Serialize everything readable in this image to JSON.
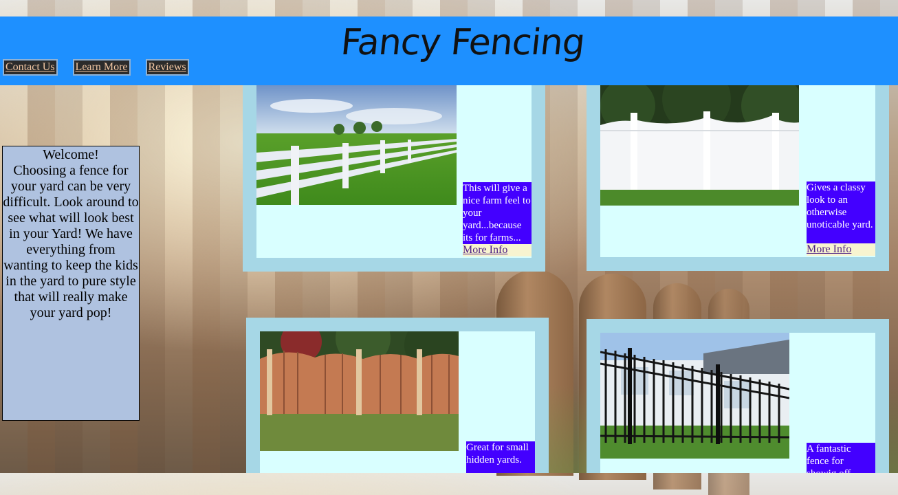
{
  "header": {
    "title": "Fancy Fencing",
    "nav": [
      "Contact Us",
      "Learn More",
      "Reviews"
    ]
  },
  "welcome": {
    "heading": "Welcome!",
    "text": "Choosing a fence for your yard can be very difficult. Look around to see what will look best in your Yard! We have everything from wanting to keep the kids in the yard to pure style that will really make your yard pop!"
  },
  "cards": [
    {
      "image": "white rail farm fence in grassy field",
      "description": "This will give a nice farm feel to your yard...because its for farms...",
      "link": "More Info"
    },
    {
      "image": "white vinyl privacy fence with picket top",
      "description": "Gives a classy look to an otherwise unoticable yard.",
      "link": "More Info"
    },
    {
      "image": "scalloped wooden spaced picket fence",
      "description": "Great for small hidden yards.",
      "link": ""
    },
    {
      "image": "black wrought iron fence in front of house",
      "description": "A fantastic fence for showig off",
      "link": ""
    }
  ],
  "colors": {
    "header_bg": "#1e90ff",
    "card_frame": "#a6d7e6",
    "card_inner": "#d9ffff",
    "desc_bg": "#4300ff",
    "welcome_bg": "#afc2e0"
  }
}
